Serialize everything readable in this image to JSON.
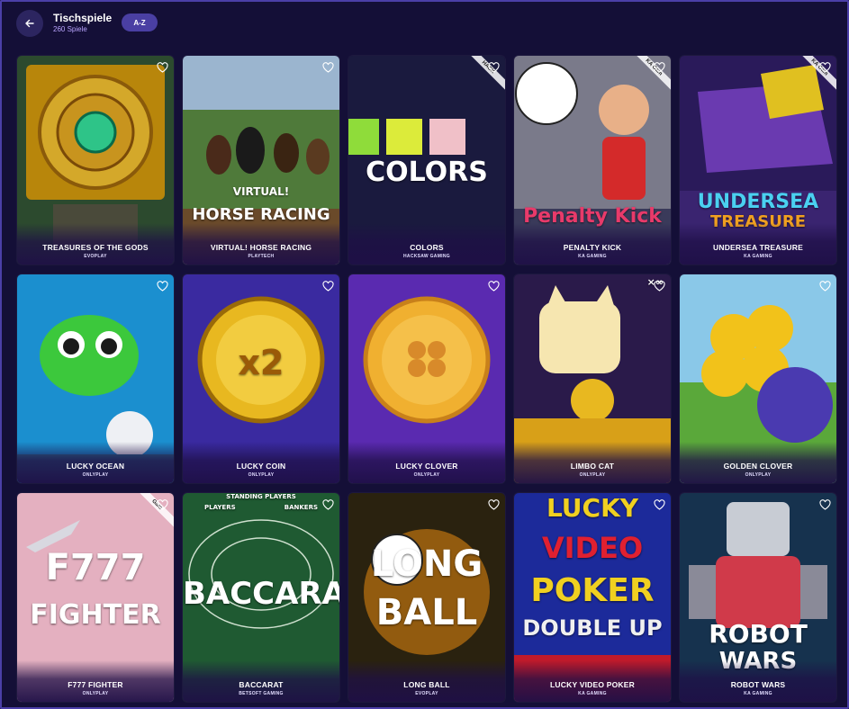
{
  "header": {
    "back_icon": "arrow-left-icon",
    "title": "Tischspiele",
    "subtitle": "260 Spiele",
    "sort_label": "A-Z"
  },
  "games": [
    {
      "name": "TREASURES OF THE GODS",
      "provider": "EVOPLAY",
      "art": "treasures",
      "colors": [
        "#3a5a3a",
        "#c89a1e"
      ]
    },
    {
      "name": "VIRTUAL! HORSE RACING",
      "provider": "PLAYTECH",
      "art": "horse",
      "art_text": [
        "VIRTUAL!",
        "HORSE RACING"
      ],
      "colors": [
        "#4f7a3a",
        "#8aa6c8"
      ]
    },
    {
      "name": "COLORS",
      "provider": "HACKSAW GAMING",
      "art": "colors",
      "art_text": [
        "COLORS"
      ],
      "tag": "HACK",
      "colors": [
        "#1a1a3a",
        "#c8e020"
      ]
    },
    {
      "name": "PENALTY KICK",
      "provider": "KA GAMING",
      "art": "penalty",
      "art_text": [
        "Penalty Kick"
      ],
      "tag": "KA Gam",
      "colors": [
        "#5a5a6a",
        "#d43030"
      ]
    },
    {
      "name": "UNDERSEA TREASURE",
      "provider": "KA GAMING",
      "art": "undersea",
      "art_text": [
        "UNDERSEA",
        "TREASURE"
      ],
      "tag": "KA Gam",
      "colors": [
        "#2a1a5a",
        "#e0a020"
      ]
    },
    {
      "name": "LUCKY OCEAN",
      "provider": "ONLYPLAY",
      "art": "ocean",
      "colors": [
        "#1e9ad0",
        "#3ccf3c"
      ]
    },
    {
      "name": "LUCKY COIN",
      "provider": "ONLYPLAY",
      "art": "coin",
      "art_text": [
        "x2"
      ],
      "colors": [
        "#3a2a9a",
        "#e8b820"
      ]
    },
    {
      "name": "LUCKY CLOVER",
      "provider": "ONLYPLAY",
      "art": "clover",
      "colors": [
        "#5a2ab0",
        "#e8a030"
      ]
    },
    {
      "name": "LIMBO CAT",
      "provider": "ONLYPLAY",
      "art": "cat",
      "art_text": [
        "×∞"
      ],
      "colors": [
        "#2a1a4a",
        "#f0d070"
      ]
    },
    {
      "name": "GOLDEN CLOVER",
      "provider": "ONLYPLAY",
      "art": "golden",
      "colors": [
        "#6ab83a",
        "#f0c020"
      ]
    },
    {
      "name": "F777 FIGHTER",
      "provider": "ONLYPLAY",
      "art": "fighter",
      "art_text": [
        "F777",
        "FIGHTER"
      ],
      "tag": "Gam",
      "colors": [
        "#e0a8b8",
        "#ffffff"
      ]
    },
    {
      "name": "BACCARAT",
      "provider": "BETSOFT GAMING",
      "art": "baccarat",
      "art_text": [
        "STANDING PLAYERS",
        "PLAYERS",
        "BANKERS",
        "BACCARAT"
      ],
      "colors": [
        "#1f5a32",
        "#ffffff"
      ]
    },
    {
      "name": "LONG BALL",
      "provider": "EVOPLAY",
      "art": "longball",
      "art_text": [
        "LONG",
        "BALL"
      ],
      "colors": [
        "#2a2a1a",
        "#f0a020"
      ]
    },
    {
      "name": "LUCKY VIDEO POKER",
      "provider": "KA GAMING",
      "art": "poker",
      "art_text": [
        "LUCKY",
        "VIDEO",
        "POKER",
        "DOUBLE UP"
      ],
      "colors": [
        "#1a2a9a",
        "#f0c020"
      ]
    },
    {
      "name": "ROBOT WARS",
      "provider": "KA GAMING",
      "art": "robot",
      "art_text": [
        "ROBOT",
        "WARS"
      ],
      "colors": [
        "#1a3a5a",
        "#d03040"
      ]
    }
  ]
}
